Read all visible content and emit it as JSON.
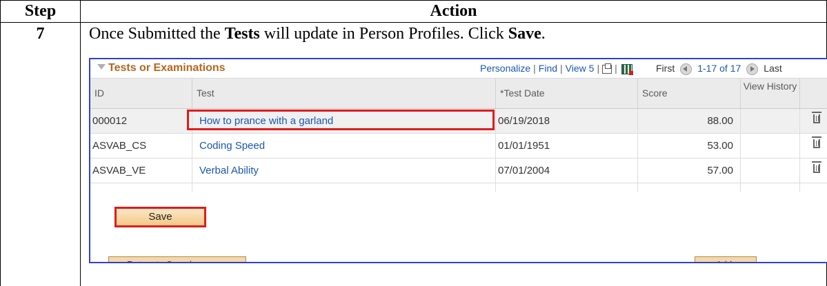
{
  "table": {
    "header_step": "Step",
    "header_action": "Action",
    "step_number": "7",
    "instruction": {
      "part1": "Once Submitted the ",
      "bold1": "Tests",
      "part2": " will update in Person Profiles. Click ",
      "bold2": "Save",
      "part3": "."
    }
  },
  "grid": {
    "title": "Tests or Examinations",
    "nav": {
      "personalize": "Personalize",
      "find": "Find",
      "view": "View 5"
    },
    "pager": {
      "first": "First",
      "range": "1-17 of 17",
      "last": "Last"
    },
    "columns": {
      "id": "ID",
      "test": "Test",
      "test_date": "*Test Date",
      "score": "Score",
      "view_history": "View History"
    },
    "rows": [
      {
        "id": "000012",
        "test": "How to prance with a garland",
        "date": "06/19/2018",
        "score": "88.00"
      },
      {
        "id": "ASVAB_CS",
        "test": "Coding Speed",
        "date": "01/01/1951",
        "score": "53.00"
      },
      {
        "id": "ASVAB_VE",
        "test": "Verbal Ability",
        "date": "07/01/2004",
        "score": "57.00"
      }
    ]
  },
  "buttons": {
    "save": "Save",
    "return_to_search": "Return to Search",
    "add": "Add"
  },
  "colors": {
    "highlight": "#e01b1b",
    "frame": "#2f3fd6",
    "link": "#1a56b0",
    "title": "#b5651d"
  }
}
